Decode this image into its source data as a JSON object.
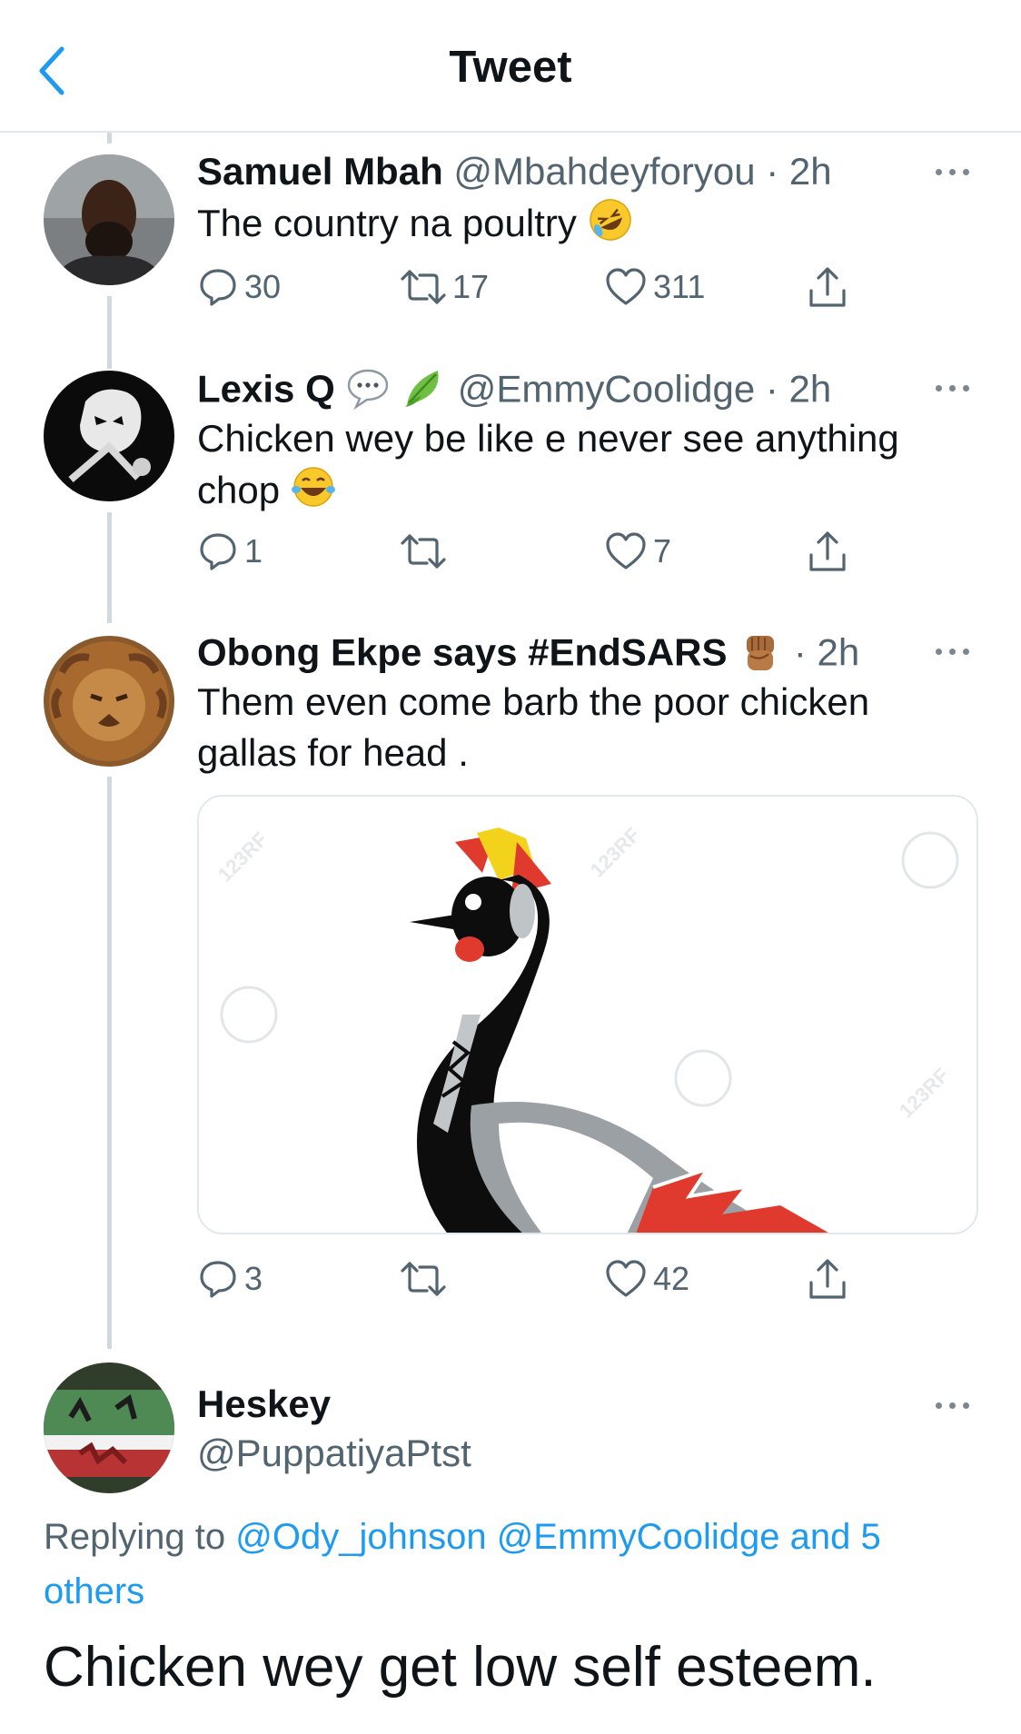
{
  "header": {
    "title": "Tweet",
    "back_icon": "chevron-left-icon"
  },
  "colors": {
    "accent": "#1d9bf0",
    "secondary_text": "#536471",
    "thread_line": "#cfd9de"
  },
  "tweets": [
    {
      "name": "Samuel Mbah",
      "handle": "@Mbahdeyforyou",
      "time": "· 2h",
      "text": "The country na poultry",
      "emoji": "rofl-emoji",
      "replies": "30",
      "retweets": "17",
      "likes": "311"
    },
    {
      "name": "Lexis Q",
      "name_emojis": [
        "speech-bubble-emoji",
        "leaf-emoji"
      ],
      "handle": "@EmmyCoolidge",
      "time": "· 2h",
      "text": "Chicken wey be like e never see anything chop",
      "emoji": "tears-of-joy-emoji",
      "replies": "1",
      "retweets": "",
      "likes": "7"
    },
    {
      "name": "Obong Ekpe says #EndSARS",
      "name_emojis": [
        "raised-fist-emoji"
      ],
      "handle": "",
      "time": "· 2h",
      "text": "Them even come barb the poor chicken gallas for head .",
      "media": "crowned-crane-image",
      "media_watermark": "123RF",
      "replies": "3",
      "retweets": "",
      "likes": "42"
    }
  ],
  "main_tweet": {
    "name": "Heskey",
    "handle": "@PuppatiyaPtst",
    "replying_prefix": "Replying to",
    "replying_links": [
      "@Ody_johnson",
      "@EmmyCoolidge",
      "and 5 others"
    ],
    "text": "Chicken wey get low self esteem."
  }
}
